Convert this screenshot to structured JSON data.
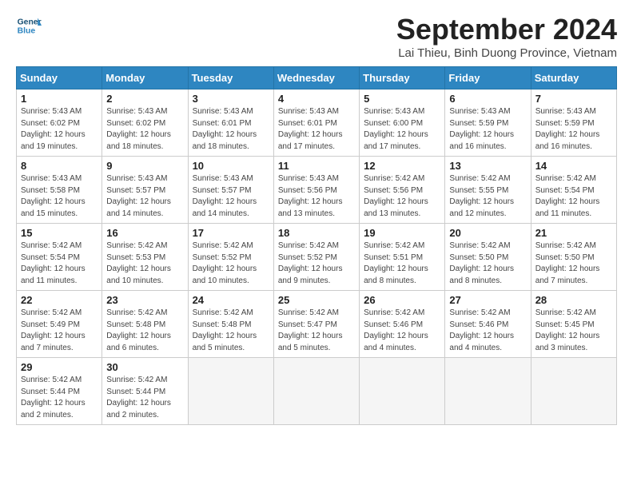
{
  "header": {
    "logo_line1": "General",
    "logo_line2": "Blue",
    "month_title": "September 2024",
    "subtitle": "Lai Thieu, Binh Duong Province, Vietnam"
  },
  "weekdays": [
    "Sunday",
    "Monday",
    "Tuesday",
    "Wednesday",
    "Thursday",
    "Friday",
    "Saturday"
  ],
  "weeks": [
    [
      {
        "day": "1",
        "info": "Sunrise: 5:43 AM\nSunset: 6:02 PM\nDaylight: 12 hours\nand 19 minutes."
      },
      {
        "day": "2",
        "info": "Sunrise: 5:43 AM\nSunset: 6:02 PM\nDaylight: 12 hours\nand 18 minutes."
      },
      {
        "day": "3",
        "info": "Sunrise: 5:43 AM\nSunset: 6:01 PM\nDaylight: 12 hours\nand 18 minutes."
      },
      {
        "day": "4",
        "info": "Sunrise: 5:43 AM\nSunset: 6:01 PM\nDaylight: 12 hours\nand 17 minutes."
      },
      {
        "day": "5",
        "info": "Sunrise: 5:43 AM\nSunset: 6:00 PM\nDaylight: 12 hours\nand 17 minutes."
      },
      {
        "day": "6",
        "info": "Sunrise: 5:43 AM\nSunset: 5:59 PM\nDaylight: 12 hours\nand 16 minutes."
      },
      {
        "day": "7",
        "info": "Sunrise: 5:43 AM\nSunset: 5:59 PM\nDaylight: 12 hours\nand 16 minutes."
      }
    ],
    [
      {
        "day": "8",
        "info": "Sunrise: 5:43 AM\nSunset: 5:58 PM\nDaylight: 12 hours\nand 15 minutes."
      },
      {
        "day": "9",
        "info": "Sunrise: 5:43 AM\nSunset: 5:57 PM\nDaylight: 12 hours\nand 14 minutes."
      },
      {
        "day": "10",
        "info": "Sunrise: 5:43 AM\nSunset: 5:57 PM\nDaylight: 12 hours\nand 14 minutes."
      },
      {
        "day": "11",
        "info": "Sunrise: 5:43 AM\nSunset: 5:56 PM\nDaylight: 12 hours\nand 13 minutes."
      },
      {
        "day": "12",
        "info": "Sunrise: 5:42 AM\nSunset: 5:56 PM\nDaylight: 12 hours\nand 13 minutes."
      },
      {
        "day": "13",
        "info": "Sunrise: 5:42 AM\nSunset: 5:55 PM\nDaylight: 12 hours\nand 12 minutes."
      },
      {
        "day": "14",
        "info": "Sunrise: 5:42 AM\nSunset: 5:54 PM\nDaylight: 12 hours\nand 11 minutes."
      }
    ],
    [
      {
        "day": "15",
        "info": "Sunrise: 5:42 AM\nSunset: 5:54 PM\nDaylight: 12 hours\nand 11 minutes."
      },
      {
        "day": "16",
        "info": "Sunrise: 5:42 AM\nSunset: 5:53 PM\nDaylight: 12 hours\nand 10 minutes."
      },
      {
        "day": "17",
        "info": "Sunrise: 5:42 AM\nSunset: 5:52 PM\nDaylight: 12 hours\nand 10 minutes."
      },
      {
        "day": "18",
        "info": "Sunrise: 5:42 AM\nSunset: 5:52 PM\nDaylight: 12 hours\nand 9 minutes."
      },
      {
        "day": "19",
        "info": "Sunrise: 5:42 AM\nSunset: 5:51 PM\nDaylight: 12 hours\nand 8 minutes."
      },
      {
        "day": "20",
        "info": "Sunrise: 5:42 AM\nSunset: 5:50 PM\nDaylight: 12 hours\nand 8 minutes."
      },
      {
        "day": "21",
        "info": "Sunrise: 5:42 AM\nSunset: 5:50 PM\nDaylight: 12 hours\nand 7 minutes."
      }
    ],
    [
      {
        "day": "22",
        "info": "Sunrise: 5:42 AM\nSunset: 5:49 PM\nDaylight: 12 hours\nand 7 minutes."
      },
      {
        "day": "23",
        "info": "Sunrise: 5:42 AM\nSunset: 5:48 PM\nDaylight: 12 hours\nand 6 minutes."
      },
      {
        "day": "24",
        "info": "Sunrise: 5:42 AM\nSunset: 5:48 PM\nDaylight: 12 hours\nand 5 minutes."
      },
      {
        "day": "25",
        "info": "Sunrise: 5:42 AM\nSunset: 5:47 PM\nDaylight: 12 hours\nand 5 minutes."
      },
      {
        "day": "26",
        "info": "Sunrise: 5:42 AM\nSunset: 5:46 PM\nDaylight: 12 hours\nand 4 minutes."
      },
      {
        "day": "27",
        "info": "Sunrise: 5:42 AM\nSunset: 5:46 PM\nDaylight: 12 hours\nand 4 minutes."
      },
      {
        "day": "28",
        "info": "Sunrise: 5:42 AM\nSunset: 5:45 PM\nDaylight: 12 hours\nand 3 minutes."
      }
    ],
    [
      {
        "day": "29",
        "info": "Sunrise: 5:42 AM\nSunset: 5:44 PM\nDaylight: 12 hours\nand 2 minutes."
      },
      {
        "day": "30",
        "info": "Sunrise: 5:42 AM\nSunset: 5:44 PM\nDaylight: 12 hours\nand 2 minutes."
      },
      {
        "day": "",
        "info": ""
      },
      {
        "day": "",
        "info": ""
      },
      {
        "day": "",
        "info": ""
      },
      {
        "day": "",
        "info": ""
      },
      {
        "day": "",
        "info": ""
      }
    ]
  ]
}
